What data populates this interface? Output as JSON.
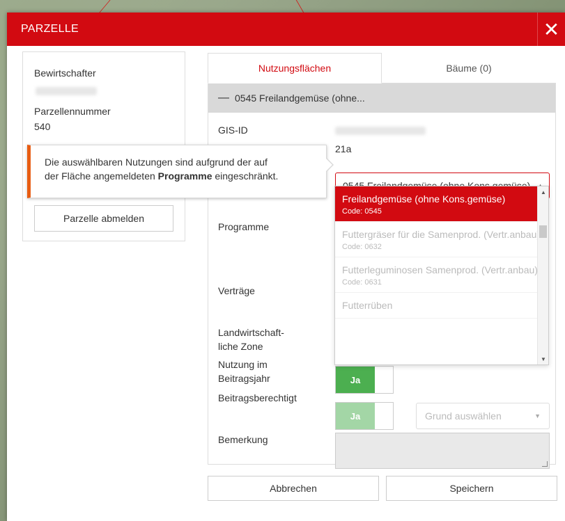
{
  "modal": {
    "title": "PARZELLE",
    "close_glyph": "✕"
  },
  "left": {
    "bewirtschafter_label": "Bewirtschafter",
    "parzellennummer_label": "Parzellennummer",
    "parzellennummer_value": "540",
    "abmelden_button": "Parzelle abmelden"
  },
  "tabs": [
    {
      "label": "Nutzungsflächen",
      "active": true
    },
    {
      "label": "Bäume (0)",
      "active": false
    }
  ],
  "panel": {
    "header_dash": "—",
    "header_title": "0545 Freilandgemüse (ohne..."
  },
  "fields": {
    "gis_id_label": "GIS-ID",
    "flaeche_value": "21a",
    "nutzung_selected": "0545 Freilandgemüse (ohne Kons.gemüse)",
    "programme_label": "Programme",
    "vertraege_label": "Verträge",
    "zone_label_1": "Landwirtschaft-",
    "zone_label_2": "liche Zone",
    "nutzung_jahr_label_1": "Nutzung im",
    "nutzung_jahr_label_2": "Beitragsjahr",
    "beitrag_label": "Beitragsberechtigt",
    "toggle_ja": "Ja",
    "grund_placeholder": "Grund auswählen",
    "bemerkung_label": "Bemerkung"
  },
  "dropdown": {
    "items": [
      {
        "name": "Freilandgemüse (ohne Kons.gemüse)",
        "code": "Code: 0545",
        "selected": true
      },
      {
        "name": "Futtergräser für die Samenprod. (Vertr.anbau)",
        "code": "Code: 0632",
        "selected": false
      },
      {
        "name": "Futterleguminosen Samenprod. (Vertr.anbau)",
        "code": "Code: 0631",
        "selected": false
      },
      {
        "name": "Futterrüben",
        "code": "",
        "selected": false
      }
    ]
  },
  "tooltip": {
    "text_1": "Die auswählbaren Nutzungen sind aufgrund der auf",
    "text_2": "der Fläche angemeldeten ",
    "text_bold": "Programme",
    "text_3": " eingeschränkt."
  },
  "footer": {
    "cancel": "Abbrechen",
    "save": "Speichern"
  },
  "colors": {
    "brand_red": "#d20a11",
    "toggle_green": "#4caf50",
    "tooltip_accent": "#e85c12"
  }
}
